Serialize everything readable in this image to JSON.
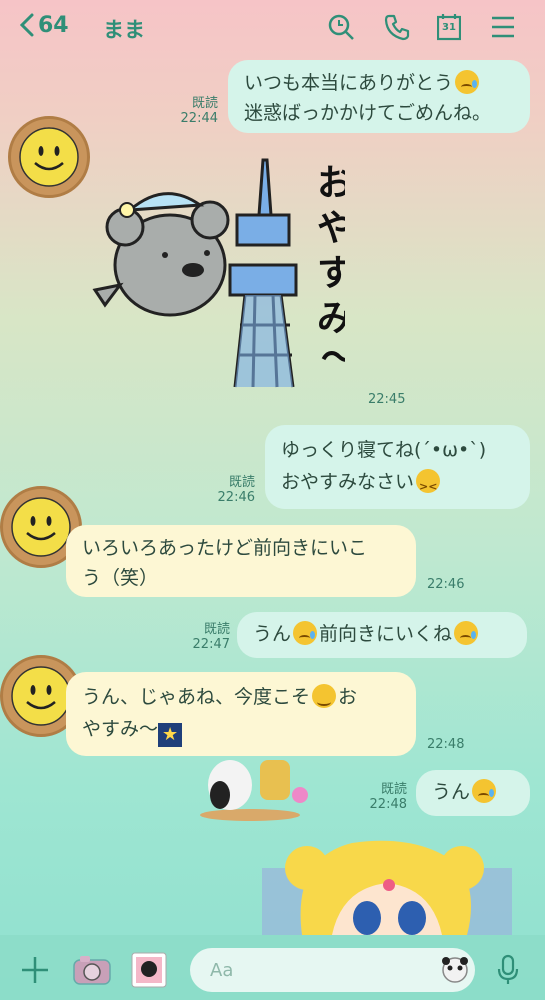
{
  "header": {
    "back_count": "64",
    "title": "まま",
    "calendar_day": "31",
    "icons": [
      "chevron-left-icon",
      "search-icon",
      "phone-icon",
      "calendar-icon",
      "menu-icon"
    ]
  },
  "messages": [
    {
      "side": "mine",
      "line1": "いつも本当にありがとう",
      "line2": "迷惑ばっかかけてごめんね。",
      "read": "既読",
      "time": "22:44"
    },
    {
      "side": "theirs",
      "type": "sticker",
      "sticker_text": "おやすみ～",
      "time": "22:45"
    },
    {
      "side": "mine",
      "line1": "ゆっくり寝てね(´•ω•`)",
      "line2": "おやすみなさい",
      "read": "既読",
      "time": "22:46"
    },
    {
      "side": "theirs",
      "line1": "いろいろあったけど前向きにいこ",
      "line2": "う（笑）",
      "time": "22:46"
    },
    {
      "side": "mine",
      "text_a": "うん",
      "text_b": "前向きにいくね",
      "read": "既読",
      "time": "22:47"
    },
    {
      "side": "theirs",
      "line1": "うん、じゃあね、今度こそ",
      "line1_end": "お",
      "line2": "やすみ～",
      "time": "22:48"
    },
    {
      "side": "mine",
      "text": "うん",
      "read": "既読",
      "time": "22:48"
    }
  ],
  "input": {
    "placeholder": "Aa"
  },
  "colors": {
    "accent": "#2f8f78",
    "mine_bubble": "#d5f4ea",
    "their_bubble": "#fdf7d4"
  }
}
